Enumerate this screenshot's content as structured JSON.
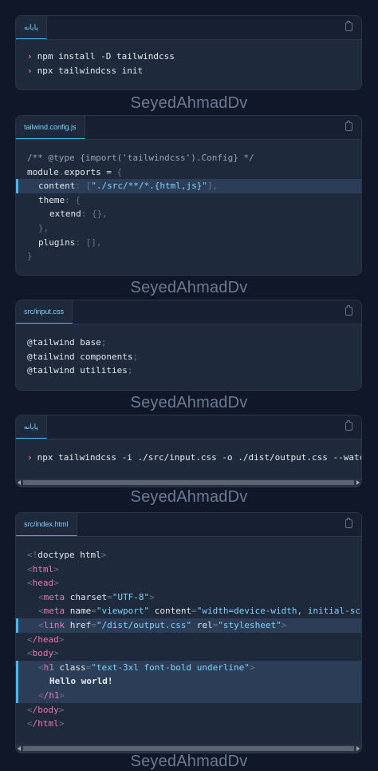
{
  "watermark": "SeyedAhmadDv",
  "panels": [
    {
      "tab": "پایانه",
      "lines": [
        "npm install -D tailwindcss",
        "npx tailwindcss init"
      ]
    },
    {
      "tab": "tailwind.config.js",
      "lines": {
        "l1a": "/** @type {import('tailwindcss').Config} */",
        "l2a": "module",
        "l2b": ".",
        "l2c": "exports",
        "l2d": " = ",
        "l2e": "{",
        "l3a": "content",
        "l3b": ": [",
        "l3c": "\"./src/**/*.{html,js}\"",
        "l3d": "],",
        "l4a": "theme",
        "l4b": ": {",
        "l5a": "extend",
        "l5b": ": {},",
        "l6a": "},",
        "l7a": "plugins",
        "l7b": ": [],",
        "l8a": "}"
      }
    },
    {
      "tab": "src/input.css",
      "lines": {
        "l1a": "@tailwind ",
        "l1b": "base",
        "l1c": ";",
        "l2a": "@tailwind ",
        "l2b": "components",
        "l2c": ";",
        "l3a": "@tailwind ",
        "l3b": "utilities",
        "l3c": ";"
      }
    },
    {
      "tab": "پایانه",
      "lines": [
        "npx tailwindcss -i ./src/input.css -o ./dist/output.css --watch"
      ]
    },
    {
      "tab": "src/index.html",
      "lines": {
        "doctype": "doctype html",
        "html": "html",
        "head": "head",
        "meta": "meta",
        "charset_attr": "charset",
        "charset_val": "\"UTF-8\"",
        "name_attr": "name",
        "name_val": "\"viewport\"",
        "content_attr": "content",
        "content_val": "\"width=device-width, initial-scale",
        "link": "link",
        "href_attr": "href",
        "href_val": "\"/dist/output.css\"",
        "rel_attr": "rel",
        "rel_val": "\"stylesheet\"",
        "head_close": "/head",
        "body": "body",
        "h1": "h1",
        "class_attr": "class",
        "class_val": "\"text-3xl font-bold underline\"",
        "hello": "Hello world!",
        "h1_close": "/h1",
        "body_close": "/body",
        "html_close": "/html"
      }
    }
  ],
  "icons": {
    "copy": "copy-icon",
    "prompt": "chevron-right-icon",
    "scroll_left": "arrow-left-icon",
    "scroll_right": "arrow-right-icon"
  }
}
